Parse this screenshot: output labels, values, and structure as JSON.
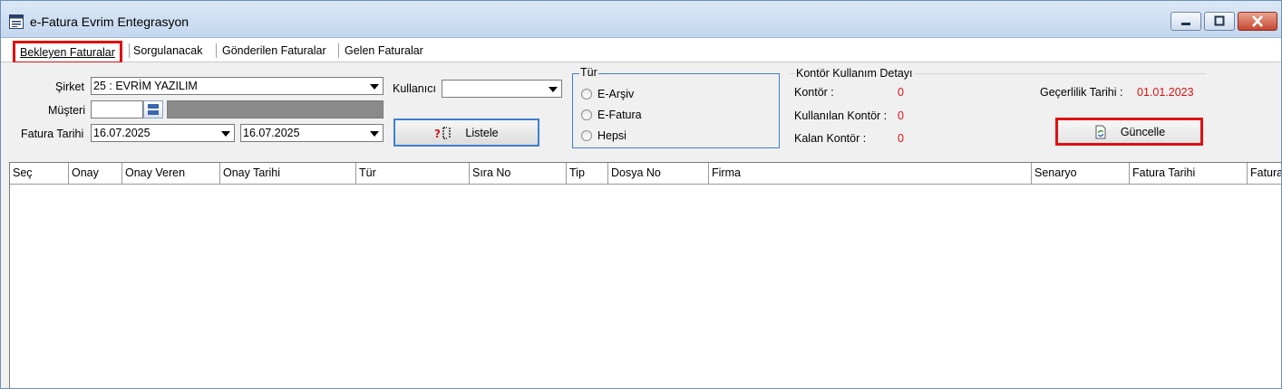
{
  "window": {
    "title": "e-Fatura Evrim Entegrasyon",
    "icon": "app-window-icon"
  },
  "tabs": [
    {
      "label": "Bekleyen Faturalar",
      "active": true
    },
    {
      "label": "Sorgulanacak",
      "active": false
    },
    {
      "label": "Gönderilen Faturalar",
      "active": false
    },
    {
      "label": "Gelen Faturalar",
      "active": false
    }
  ],
  "filters": {
    "sirket_label": "Şirket",
    "sirket_value": "25 : EVRİM YAZILIM",
    "musteri_label": "Müşteri",
    "musteri_value": "",
    "fatura_tarihi_label": "Fatura Tarihi",
    "date_from": "16.07.2025",
    "date_to": "16.07.2025",
    "kullanici_label": "Kullanıcı",
    "kullanici_value": "",
    "listele_label": "Listele"
  },
  "tur": {
    "title": "Tür",
    "options": [
      "E-Arşiv",
      "E-Fatura",
      "Hepsi"
    ]
  },
  "kontor": {
    "title": "Kontör Kullanım Detayı",
    "kontor_label": "Kontör :",
    "kontor_value": "0",
    "kullanilan_label": "Kullanılan Kontör :",
    "kullanilan_value": "0",
    "kalan_label": "Kalan Kontör :",
    "kalan_value": "0",
    "gecerlilik_label": "Geçerlilik Tarihi :",
    "gecerlilik_value": "01.01.2023",
    "guncelle_label": "Güncelle"
  },
  "grid": {
    "columns": [
      "Seç",
      "Onay",
      "Onay Veren",
      "Onay Tarihi",
      "Tür",
      "Sıra No",
      "Tip",
      "Dosya No",
      "Firma",
      "Senaryo",
      "Fatura Tarihi",
      "Fatura"
    ]
  },
  "colors": {
    "highlight": "#e01010",
    "accent": "#3c7fd0",
    "value_red": "#e01010"
  }
}
